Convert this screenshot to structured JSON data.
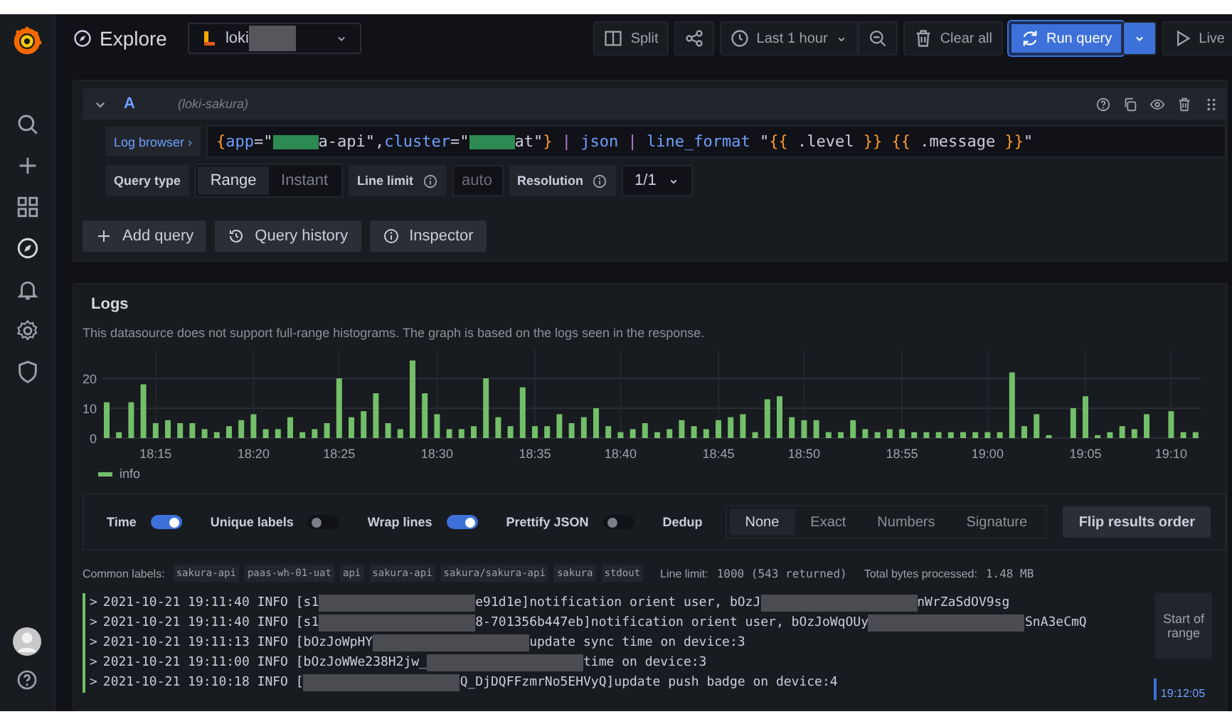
{
  "sidebar": {
    "items": [
      {
        "kind": "search",
        "selected": false
      },
      {
        "kind": "plus",
        "selected": false
      },
      {
        "kind": "grid",
        "selected": false
      },
      {
        "kind": "compass",
        "selected": true
      },
      {
        "kind": "bell",
        "selected": false
      },
      {
        "kind": "gear",
        "selected": false
      },
      {
        "kind": "shield",
        "selected": false
      }
    ],
    "bottom": [
      {
        "kind": "avatar"
      },
      {
        "kind": "help"
      }
    ]
  },
  "toolbar": {
    "title": "Explore",
    "datasource": "loki",
    "buttons": [
      {
        "kind": "split",
        "label": "Split"
      },
      {
        "kind": "share"
      },
      {
        "kind": "time",
        "label": "Last 1 hour"
      },
      {
        "kind": "zoom"
      },
      {
        "kind": "clear",
        "label": "Clear all"
      },
      {
        "kind": "run",
        "label": "Run query"
      },
      {
        "kind": "run-menu"
      },
      {
        "kind": "live",
        "label": "Live"
      }
    ]
  },
  "query": {
    "ref": "A",
    "datasource": "(loki-sakura)",
    "expanded": true,
    "browser_label": "Log browser ›",
    "tokens": [
      {
        "kind": "brace",
        "text": "{"
      },
      {
        "kind": "key",
        "text": "app"
      },
      {
        "kind": "op",
        "text": "=\""
      },
      {
        "kind": "redacted"
      },
      {
        "kind": "string",
        "text": "a-api\""
      },
      {
        "kind": "op",
        "text": ","
      },
      {
        "kind": "key",
        "text": "cluster"
      },
      {
        "kind": "op",
        "text": "=\""
      },
      {
        "kind": "redacted"
      },
      {
        "kind": "string",
        "text": "at\""
      },
      {
        "kind": "brace",
        "text": "}"
      },
      {
        "kind": "pipe",
        "text": " | "
      },
      {
        "kind": "func",
        "text": "json"
      },
      {
        "kind": "pipe",
        "text": " | "
      },
      {
        "kind": "func",
        "text": "line_format"
      },
      {
        "kind": "op",
        "text": " \""
      },
      {
        "kind": "brace",
        "text": "{{"
      },
      {
        "kind": "op",
        "text": " .level "
      },
      {
        "kind": "brace",
        "text": "}}"
      },
      {
        "kind": "brace",
        "text": " {{"
      },
      {
        "kind": "op",
        "text": " .message "
      },
      {
        "kind": "brace",
        "text": "}}"
      },
      {
        "kind": "op",
        "text": "\""
      }
    ],
    "query_type_label": "Query type",
    "query_types": [
      {
        "label": "Range",
        "selected": true
      },
      {
        "label": "Instant",
        "selected": false
      }
    ],
    "line_limit_label": "Line limit",
    "line_limit_placeholder": "auto",
    "resolution_label": "Resolution",
    "resolution": "1/1"
  },
  "query_actions": [
    {
      "kind": "add",
      "label": "Add query"
    },
    {
      "kind": "history",
      "label": "Query history"
    },
    {
      "kind": "inspector",
      "label": "Inspector"
    }
  ],
  "logs": {
    "title": "Logs",
    "notice": "This datasource does not support full-range histograms. The graph is based on the logs seen in the response.",
    "chart_data": {
      "type": "bar",
      "categories": [
        null,
        null,
        null,
        null,
        "18:15",
        null,
        null,
        null,
        null,
        null,
        null,
        null,
        "18:20",
        null,
        null,
        null,
        null,
        null,
        null,
        "18:25",
        null,
        null,
        null,
        null,
        null,
        null,
        null,
        "18:30",
        null,
        null,
        null,
        null,
        null,
        null,
        null,
        "18:35",
        null,
        null,
        null,
        null,
        null,
        null,
        "18:40",
        null,
        null,
        null,
        null,
        null,
        null,
        null,
        "18:45",
        null,
        null,
        null,
        null,
        null,
        null,
        "18:50",
        null,
        null,
        null,
        null,
        null,
        null,
        null,
        "18:55",
        null,
        null,
        null,
        null,
        null,
        null,
        "19:00",
        null,
        null,
        null,
        null,
        null,
        null,
        null,
        "19:05",
        null,
        null,
        null,
        null,
        null,
        null,
        "19:10",
        null,
        null
      ],
      "series": [
        {
          "name": "info",
          "color": "#73bf69",
          "values": [
            12,
            2,
            12,
            18,
            5,
            6,
            5,
            5,
            3,
            2,
            4,
            6,
            8,
            3,
            3,
            7,
            2,
            3,
            5,
            20,
            7,
            9,
            15,
            5,
            3,
            26,
            15,
            8,
            3,
            3,
            4,
            20,
            7,
            4,
            17,
            4,
            4,
            8,
            5,
            7,
            10,
            4,
            2,
            3,
            5,
            2,
            3,
            6,
            4,
            3,
            6,
            7,
            8,
            2,
            13,
            14,
            7,
            6,
            6,
            2,
            2,
            6,
            3,
            2,
            3,
            3,
            2,
            2,
            2,
            2,
            2,
            2,
            2,
            2,
            22,
            4,
            8,
            1,
            0,
            10,
            14,
            1,
            2,
            4,
            3,
            8,
            0,
            9,
            2,
            2
          ]
        }
      ],
      "ylim": [
        0,
        30
      ],
      "yticks": [
        0,
        10,
        20
      ],
      "grid": true
    },
    "toggles": [
      {
        "label": "Time",
        "on": true
      },
      {
        "label": "Unique labels",
        "on": false
      },
      {
        "label": "Wrap lines",
        "on": true
      },
      {
        "label": "Prettify JSON",
        "on": false
      }
    ],
    "dedup_label": "Dedup",
    "dedup": [
      {
        "label": "None",
        "selected": true
      },
      {
        "label": "Exact",
        "selected": false
      },
      {
        "label": "Numbers",
        "selected": false
      },
      {
        "label": "Signature",
        "selected": false
      }
    ],
    "flip_button": "Flip results order",
    "common_labels_title": "Common labels:",
    "common_labels": [
      "sakura-api",
      "paas-wh-01-uat",
      "api",
      "sakura-api",
      "sakura/sakura-api",
      "sakura",
      "stdout"
    ],
    "line_limit_title": "Line limit:",
    "line_limit_value": "1000 (543 returned)",
    "bytes_title": "Total bytes processed:",
    "bytes_value": "1.48 MB",
    "lines": [
      {
        "expand": ">",
        "parts": [
          "2021-10-21 19:11:40 INFO [s1",
          "e91d1e]notification orient user, bOzJ",
          "nWrZaSdOV9sg"
        ]
      },
      {
        "expand": ">",
        "parts": [
          "2021-10-21 19:11:40 INFO [s1",
          "8-701356b447eb]notification orient user, bOzJoWqOUy",
          "SnA3eCmQ"
        ]
      },
      {
        "expand": ">",
        "parts": [
          "2021-10-21 19:11:13 INFO [bOzJoWpHY",
          "update sync time on device:3"
        ]
      },
      {
        "expand": ">",
        "parts": [
          "2021-10-21 19:11:00 INFO [bOzJoWWe238H2jw_",
          "time on device:3"
        ]
      },
      {
        "expand": ">",
        "parts": [
          "2021-10-21 19:10:18 INFO [",
          "Q_DjDQFFzmrNo5EHVyQ]update push badge on device:4"
        ]
      }
    ],
    "range_button": "Start of range",
    "range_time": "19:12:05"
  }
}
